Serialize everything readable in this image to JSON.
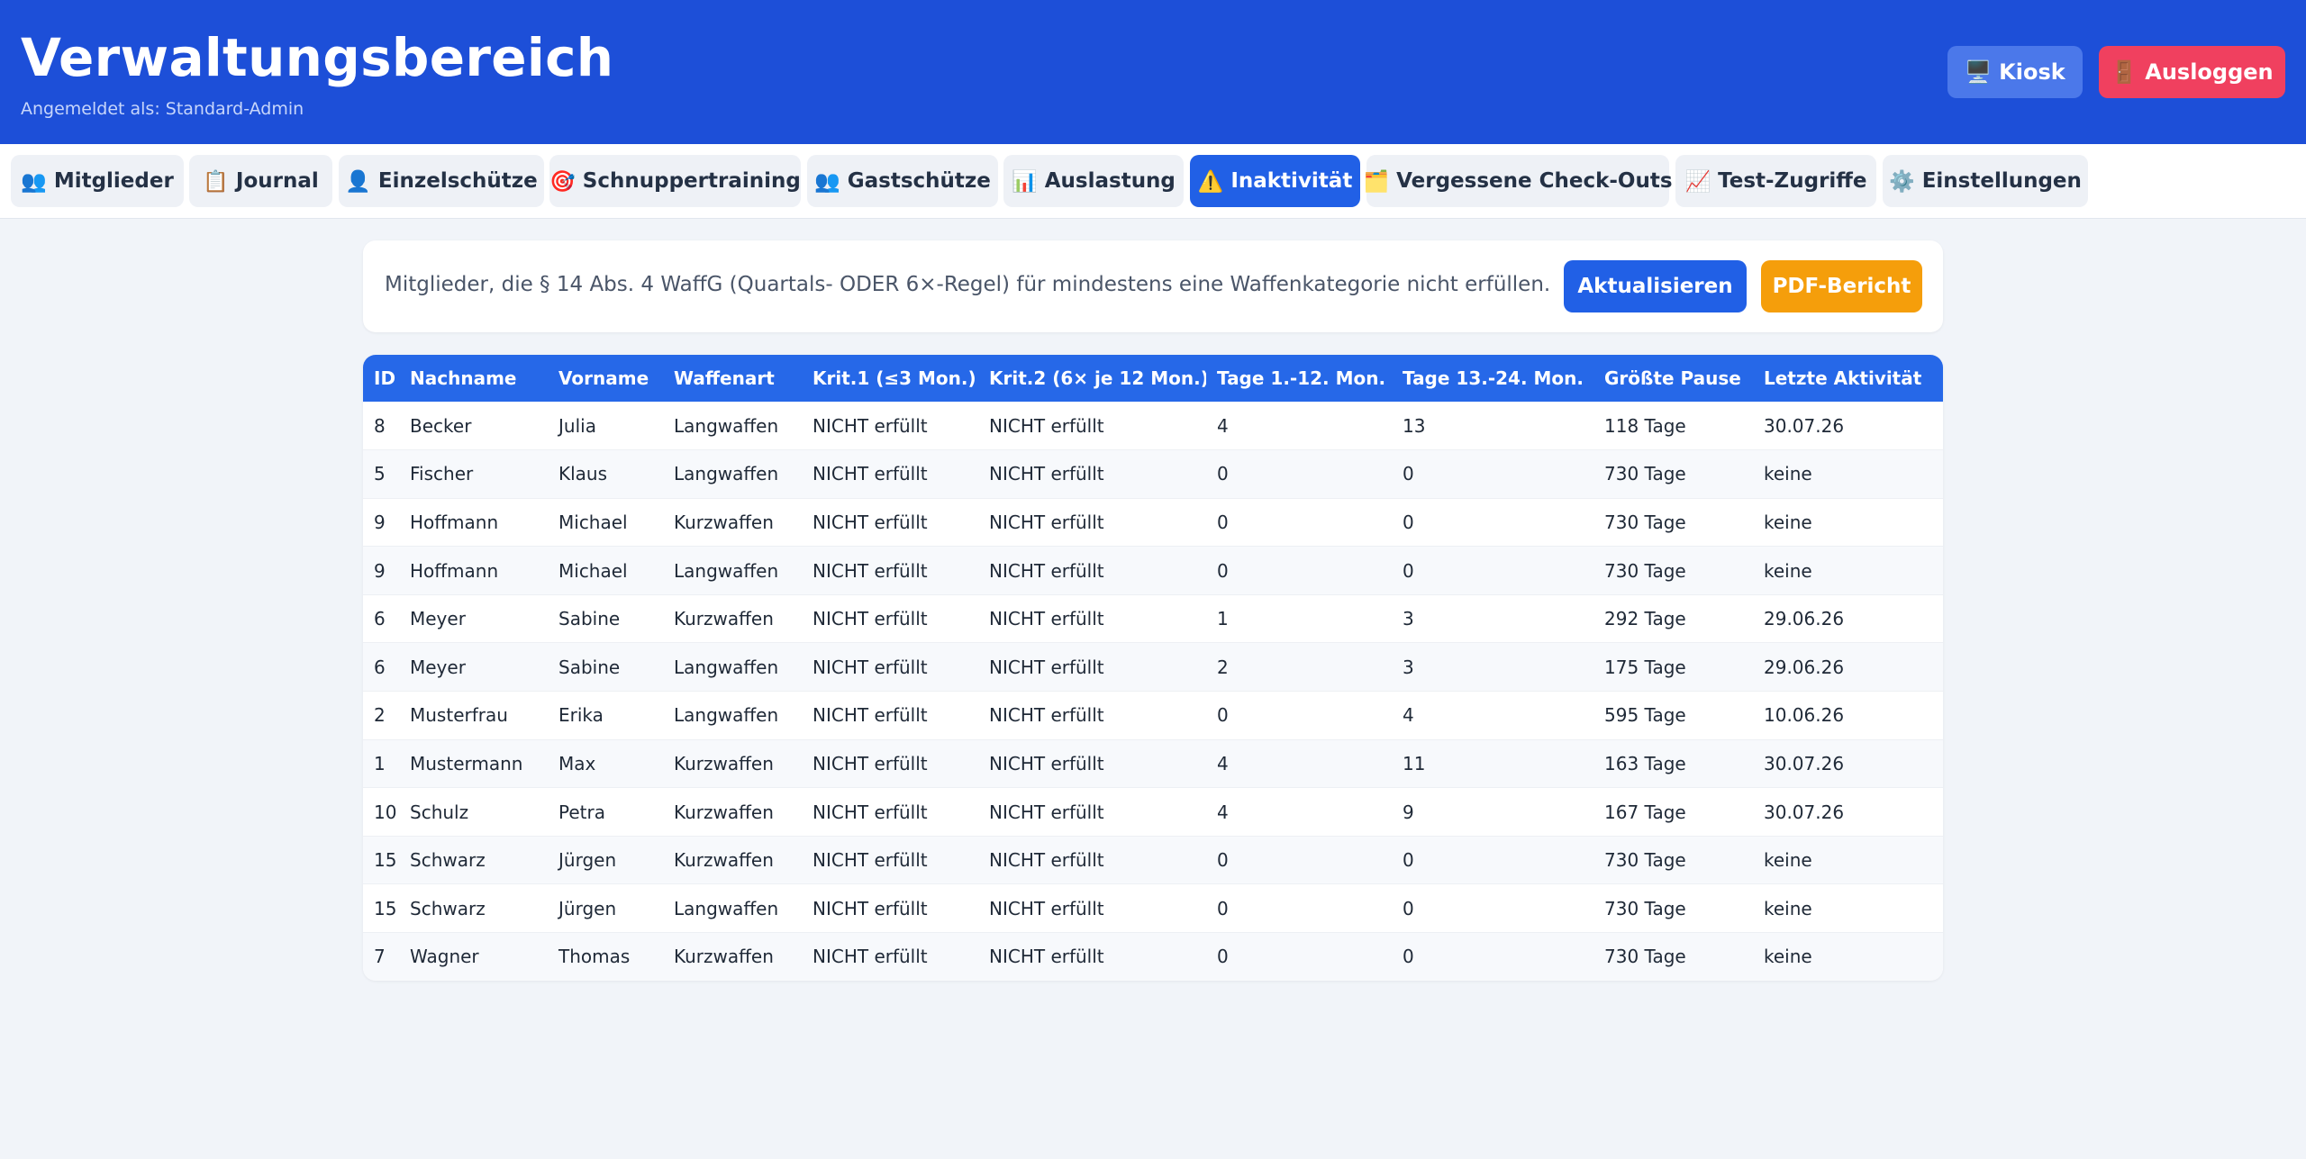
{
  "header": {
    "title": "Verwaltungsbereich",
    "subtitle": "Angemeldet als: Standard-Admin",
    "kiosk_icon": "🖥️",
    "kiosk_label": "Kiosk",
    "logout_icon": "🚪",
    "logout_label": "Ausloggen",
    "colors": {
      "brand": "#1d4fd8",
      "logout": "#f0405f"
    }
  },
  "tabs": [
    {
      "icon": "👥",
      "label": "Mitglieder"
    },
    {
      "icon": "📋",
      "label": "Journal"
    },
    {
      "icon": "👤",
      "label": "Einzelschütze"
    },
    {
      "icon": "🎯",
      "label": "Schnuppertraining"
    },
    {
      "icon": "👥",
      "label": "Gastschütze"
    },
    {
      "icon": "📊",
      "label": "Auslastung"
    },
    {
      "icon": "⚠️",
      "label": "Inaktivität",
      "active": true
    },
    {
      "icon": "🗂️",
      "label": "Vergessene Check-Outs"
    },
    {
      "icon": "📈",
      "label": "Test-Zugriffe"
    },
    {
      "icon": "⚙️",
      "label": "Einstellungen"
    }
  ],
  "info": {
    "description": "Mitglieder, die § 14 Abs. 4 WaffG (Quartals- ODER 6×-Regel) für mindestens eine Waffenkategorie nicht erfüllen.",
    "refresh_label": "Aktualisieren",
    "pdf_label": "PDF-Bericht"
  },
  "table": {
    "columns": [
      "ID",
      "Nachname",
      "Vorname",
      "Waffenart",
      "Krit.1 (≤3 Mon.)",
      "Krit.2 (6× je 12 Mon.)",
      "Tage 1.-12. Mon.",
      "Tage 13.-24. Mon.",
      "Größte Pause",
      "Letzte Aktivität"
    ],
    "rows": [
      [
        "8",
        "Becker",
        "Julia",
        "Langwaffen",
        "NICHT erfüllt",
        "NICHT erfüllt",
        "4",
        "13",
        "118 Tage",
        "30.07.26"
      ],
      [
        "5",
        "Fischer",
        "Klaus",
        "Langwaffen",
        "NICHT erfüllt",
        "NICHT erfüllt",
        "0",
        "0",
        "730 Tage",
        "keine"
      ],
      [
        "9",
        "Hoffmann",
        "Michael",
        "Kurzwaffen",
        "NICHT erfüllt",
        "NICHT erfüllt",
        "0",
        "0",
        "730 Tage",
        "keine"
      ],
      [
        "9",
        "Hoffmann",
        "Michael",
        "Langwaffen",
        "NICHT erfüllt",
        "NICHT erfüllt",
        "0",
        "0",
        "730 Tage",
        "keine"
      ],
      [
        "6",
        "Meyer",
        "Sabine",
        "Kurzwaffen",
        "NICHT erfüllt",
        "NICHT erfüllt",
        "1",
        "3",
        "292 Tage",
        "29.06.26"
      ],
      [
        "6",
        "Meyer",
        "Sabine",
        "Langwaffen",
        "NICHT erfüllt",
        "NICHT erfüllt",
        "2",
        "3",
        "175 Tage",
        "29.06.26"
      ],
      [
        "2",
        "Musterfrau",
        "Erika",
        "Langwaffen",
        "NICHT erfüllt",
        "NICHT erfüllt",
        "0",
        "4",
        "595 Tage",
        "10.06.26"
      ],
      [
        "1",
        "Mustermann",
        "Max",
        "Kurzwaffen",
        "NICHT erfüllt",
        "NICHT erfüllt",
        "4",
        "11",
        "163 Tage",
        "30.07.26"
      ],
      [
        "10",
        "Schulz",
        "Petra",
        "Kurzwaffen",
        "NICHT erfüllt",
        "NICHT erfüllt",
        "4",
        "9",
        "167 Tage",
        "30.07.26"
      ],
      [
        "15",
        "Schwarz",
        "Jürgen",
        "Kurzwaffen",
        "NICHT erfüllt",
        "NICHT erfüllt",
        "0",
        "0",
        "730 Tage",
        "keine"
      ],
      [
        "15",
        "Schwarz",
        "Jürgen",
        "Langwaffen",
        "NICHT erfüllt",
        "NICHT erfüllt",
        "0",
        "0",
        "730 Tage",
        "keine"
      ],
      [
        "7",
        "Wagner",
        "Thomas",
        "Kurzwaffen",
        "NICHT erfüllt",
        "NICHT erfüllt",
        "0",
        "0",
        "730 Tage",
        "keine"
      ]
    ]
  }
}
